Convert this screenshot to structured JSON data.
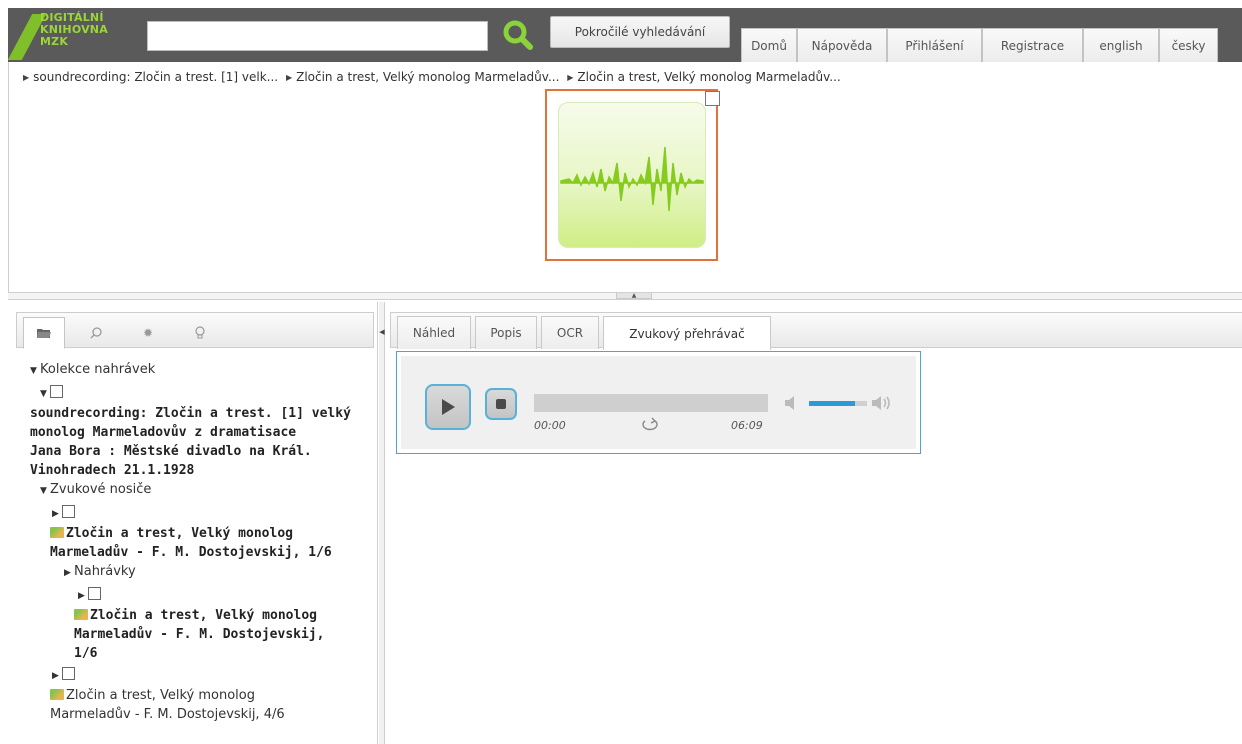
{
  "logo": {
    "line1": "DIGITÁLNÍ",
    "line2": "KNIHOVNA",
    "line3": "MZK"
  },
  "search": {
    "value": "",
    "placeholder": ""
  },
  "advanced_search_label": "Pokročilé vyhledávání",
  "nav": [
    "Domů",
    "Nápověda",
    "Přihlášení",
    "Registrace",
    "english",
    "česky"
  ],
  "breadcrumb": [
    "soundrecording: Zločin a trest. [1] velk...",
    "Zločin a trest, Velký monolog Marmeladův...",
    "Zločin a trest, Velký monolog Marmeladův..."
  ],
  "left_tabs": [
    "folder-icon",
    "search-icon",
    "gear-icon",
    "lightbulb-icon"
  ],
  "tree": {
    "root": "Kolekce nahrávek",
    "recording_title_lines": [
      "soundrecording: Zločin a trest. [1] velký",
      "monolog Marmeladovův z dramatisace",
      "Jana Bora : Městské divadlo na Král.",
      "Vinohradech 21.1.1928"
    ],
    "carriers": "Zvukové nosiče",
    "carrier1_lines": [
      "Zločin a trest, Velký monolog",
      "Marmeladův - F. M. Dostojevskij, 1/6"
    ],
    "recordings": "Nahrávky",
    "recording1_lines": [
      "Zločin a trest, Velký monolog",
      "Marmeladův - F. M. Dostojevskij,",
      "1/6"
    ],
    "carrier2_lines": [
      "Zločin a trest, Velký monolog",
      "Marmeladův - F. M. Dostojevskij, 4/6"
    ]
  },
  "right_tabs": [
    "Náhled",
    "Popis",
    "OCR",
    "Zvukový přehrávač"
  ],
  "active_right_tab": "Zvukový přehrávač",
  "player": {
    "current_time": "00:00",
    "total_time": "06:09",
    "progress": 0,
    "volume": 0.8
  },
  "colors": {
    "accent": "#2a9bd6",
    "thumb_border": "#e0723a",
    "header_bg": "#5a5a5a",
    "logo_green": "#9bd53a"
  }
}
